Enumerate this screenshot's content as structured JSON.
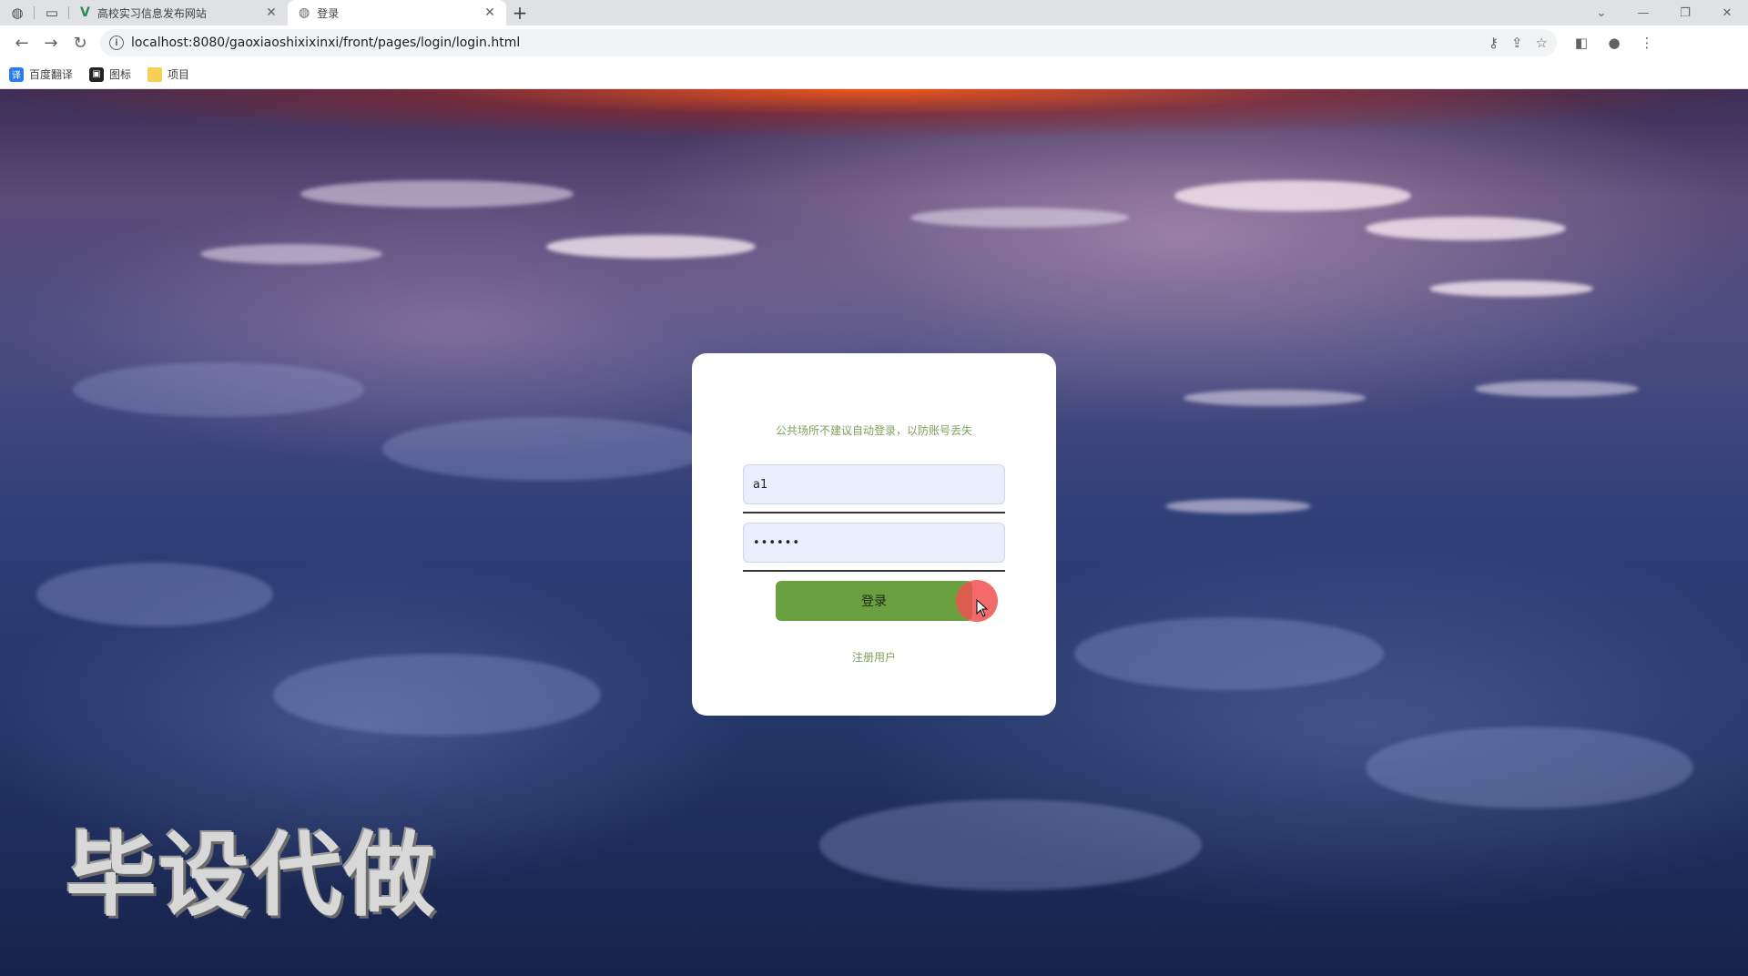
{
  "browser": {
    "tabs": [
      {
        "title": "高校实习信息发布网站",
        "favicon": "v-logo-icon",
        "active": false
      },
      {
        "title": "登录",
        "favicon": "globe-icon",
        "active": true
      }
    ],
    "address_url": "localhost:8080/gaoxiaoshixixinxi/front/pages/login/login.html",
    "bookmarks": [
      {
        "label": "百度翻译",
        "icon": "translate-icon"
      },
      {
        "label": "图标",
        "icon": "image-icon"
      },
      {
        "label": "项目",
        "icon": "folder-icon"
      }
    ]
  },
  "login": {
    "notice": "公共场所不建议自动登录，以防账号丢失",
    "username_value": "a1",
    "password_value": "••••••",
    "login_button": "登录",
    "register_link": "注册用户"
  },
  "watermark": "毕设代做",
  "colors": {
    "accent_green": "#6aa03f",
    "notice_text": "#7aa35a",
    "input_bg": "#e8f0fe",
    "click_indicator": "#f05050"
  }
}
